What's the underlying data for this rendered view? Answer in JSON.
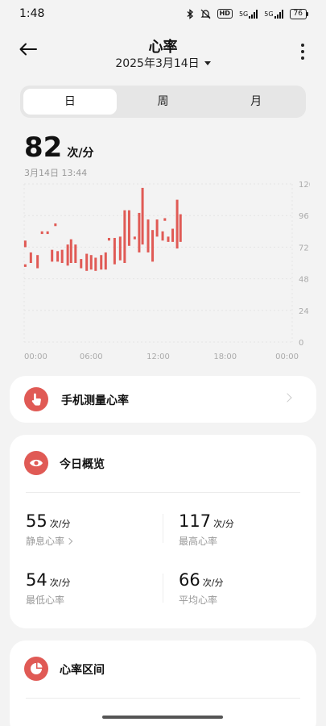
{
  "status_bar": {
    "time": "1:48",
    "net1": "5G",
    "net2": "5G",
    "hd": "HD",
    "battery": "76"
  },
  "header": {
    "title": "心率",
    "date": "2025年3月14日"
  },
  "tabs": [
    "日",
    "周",
    "月"
  ],
  "current": {
    "value": "82",
    "unit": "次/分",
    "timestamp": "3月14日 13:44"
  },
  "chart_data": {
    "type": "bar",
    "y_ticks": [
      "120",
      "96",
      "72",
      "48",
      "24",
      "0"
    ],
    "x_ticks": [
      "00:00",
      "06:00",
      "12:00",
      "18:00",
      "00:00"
    ],
    "ylim": [
      0,
      120
    ],
    "xlim_hours": [
      0,
      24
    ],
    "bar_color": "#e05a55",
    "ranges": [
      [
        0.1,
        72,
        77
      ],
      [
        0.1,
        57,
        59
      ],
      [
        0.6,
        60,
        68
      ],
      [
        1.2,
        56,
        66
      ],
      [
        1.6,
        82,
        84
      ],
      [
        2.1,
        82,
        84
      ],
      [
        2.5,
        61,
        70
      ],
      [
        2.8,
        88,
        90
      ],
      [
        3.0,
        61,
        69
      ],
      [
        3.4,
        60,
        70
      ],
      [
        3.9,
        58,
        74
      ],
      [
        4.2,
        60,
        78
      ],
      [
        4.6,
        60,
        74
      ],
      [
        5.1,
        56,
        63
      ],
      [
        5.6,
        54,
        67
      ],
      [
        6.0,
        55,
        66
      ],
      [
        6.4,
        54,
        64
      ],
      [
        6.9,
        55,
        66
      ],
      [
        7.3,
        55,
        68
      ],
      [
        7.6,
        77,
        79
      ],
      [
        8.1,
        59,
        79
      ],
      [
        8.6,
        62,
        80
      ],
      [
        9.0,
        60,
        100
      ],
      [
        9.4,
        73,
        100
      ],
      [
        9.9,
        78,
        80
      ],
      [
        10.3,
        68,
        98
      ],
      [
        10.6,
        74,
        117
      ],
      [
        11.1,
        68,
        93
      ],
      [
        11.5,
        61,
        85
      ],
      [
        11.9,
        80,
        93
      ],
      [
        12.4,
        77,
        84
      ],
      [
        12.6,
        92,
        94
      ],
      [
        12.9,
        76,
        80
      ],
      [
        13.3,
        76,
        86
      ],
      [
        13.7,
        71,
        108
      ],
      [
        14.0,
        76,
        97
      ]
    ]
  },
  "measure": {
    "label": "手机测量心率"
  },
  "overview": {
    "title": "今日概览",
    "stats": [
      {
        "value": "55",
        "unit": "次/分",
        "label": "静息心率"
      },
      {
        "value": "117",
        "unit": "次/分",
        "label": "最高心率"
      },
      {
        "value": "54",
        "unit": "次/分",
        "label": "最低心率"
      },
      {
        "value": "66",
        "unit": "次/分",
        "label": "平均心率"
      }
    ]
  },
  "zones": {
    "title": "心率区间"
  },
  "colors": {
    "accent": "#e05a55",
    "background": "#f3f3f3"
  }
}
